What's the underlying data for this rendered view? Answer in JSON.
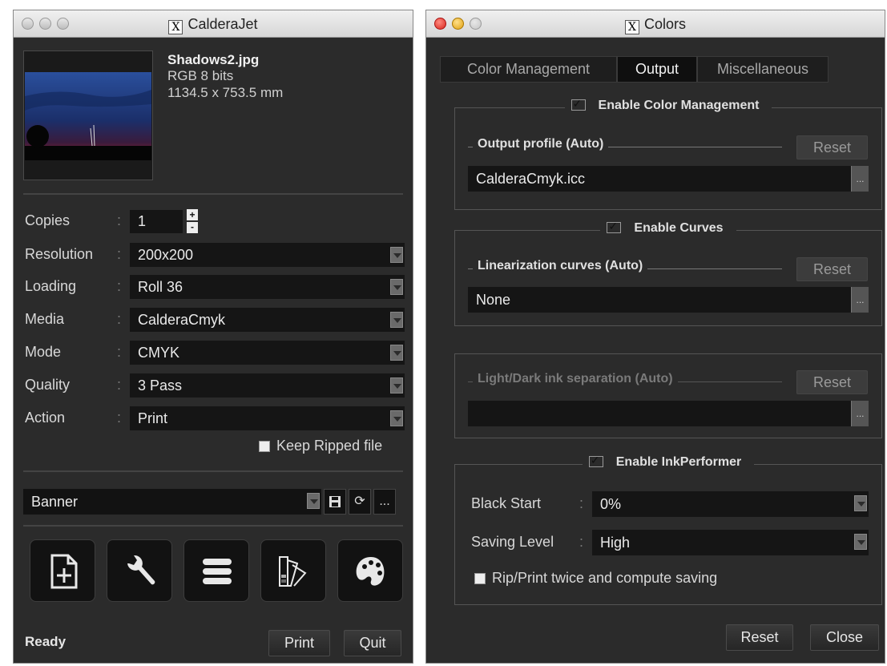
{
  "left_window": {
    "title": "CalderaJet",
    "file": {
      "name": "Shadows2.jpg",
      "color": "RGB 8 bits",
      "size": "1134.5 x 753.5 mm"
    },
    "settings": [
      {
        "label": "Copies",
        "value": "1"
      },
      {
        "label": "Resolution",
        "value": "200x200"
      },
      {
        "label": "Loading",
        "value": "Roll 36"
      },
      {
        "label": "Media",
        "value": "CalderaCmyk"
      },
      {
        "label": "Mode",
        "value": "CMYK"
      },
      {
        "label": "Quality",
        "value": "3 Pass"
      },
      {
        "label": "Action",
        "value": "Print"
      }
    ],
    "keep_ripped": {
      "label": "Keep Ripped file",
      "checked": false
    },
    "preset": {
      "value": "Banner",
      "more": "..."
    },
    "tools": [
      "add-file-icon",
      "wrench-icon",
      "queue-list-icon",
      "swatch-fan-icon",
      "palette-icon"
    ],
    "status": "Ready",
    "print_label": "Print",
    "quit_label": "Quit"
  },
  "right_window": {
    "title": "Colors",
    "tabs": [
      {
        "label": "Color Management",
        "active": false
      },
      {
        "label": "Output",
        "active": true
      },
      {
        "label": "Miscellaneous",
        "active": false
      }
    ],
    "color_management": {
      "label": "Enable Color Management",
      "checked": true,
      "output_profile_label": "Output profile (Auto)",
      "reset": "Reset",
      "output_profile_value": "CalderaCmyk.icc",
      "more": "..."
    },
    "curves": {
      "label": "Enable Curves",
      "checked": true,
      "linearization_label": "Linearization curves (Auto)",
      "reset": "Reset",
      "linearization_value": "None",
      "more": "..."
    },
    "ink_separation": {
      "label": "Light/Dark ink separation (Auto)",
      "reset": "Reset",
      "value": "",
      "more": "..."
    },
    "inkperformer": {
      "label": "Enable InkPerformer",
      "checked": true,
      "black_start_label": "Black Start",
      "black_start_value": "0%",
      "saving_level_label": "Saving Level",
      "saving_level_value": "High",
      "rip_twice_label": "Rip/Print twice and compute saving",
      "rip_twice_checked": false
    },
    "reset_label": "Reset",
    "close_label": "Close"
  },
  "colors": {
    "window_bg": "#2b2b2b",
    "field_bg": "#151515",
    "text": "#d8d8d8"
  }
}
